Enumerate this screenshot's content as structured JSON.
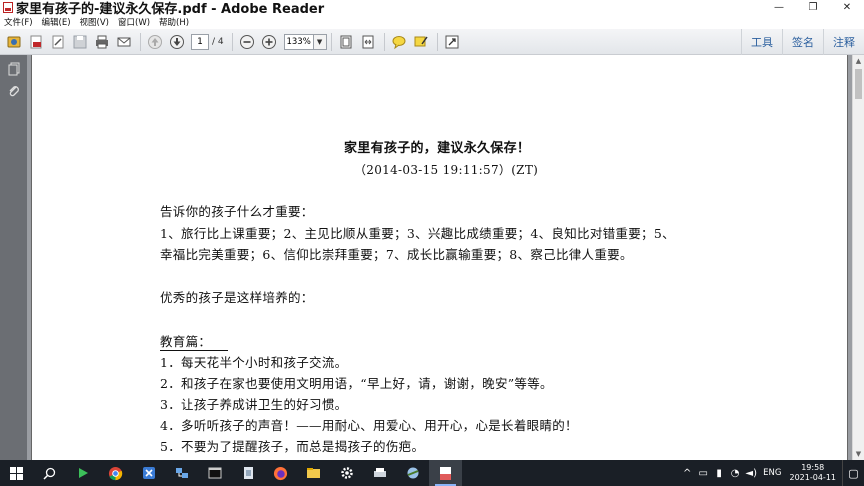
{
  "window": {
    "title": "家里有孩子的-建议永久保存.pdf - Adobe Reader",
    "minimize": "—",
    "restore": "❐",
    "close": "✕"
  },
  "menu": {
    "items": [
      "文件(F)",
      "编辑(E)",
      "视图(V)",
      "窗口(W)",
      "帮助(H)"
    ]
  },
  "toolbar": {
    "page_current": "1",
    "page_total": "/ 4",
    "zoom": "133%",
    "right_links": [
      "工具",
      "签名",
      "注释"
    ]
  },
  "document": {
    "title": "家里有孩子的，建议永久保存！",
    "date": "（2014-03-15 19:11:57）(ZT)",
    "section1_heading": "告诉你的孩子什么才重要：",
    "section1_line1": "1、旅行比上课重要；2、主见比顺从重要；3、兴趣比成绩重要；4、良知比对错重要；5、",
    "section1_line2": "幸福比完美重要；6、信仰比崇拜重要；7、成长比赢输重要；8、察己比律人重要。",
    "section2_heading": "优秀的孩子是这样培养的：",
    "section3_heading": "教育篇：",
    "items": [
      "1．每天花半个小时和孩子交流。",
      "2．和孩子在家也要使用文明用语，“早上好，请，谢谢，晚安”等等。",
      "3．让孩子养成讲卫生的好习惯。",
      "4．多听听孩子的声音！——用耐心、用爱心、用开心，心是长着眼睛的！",
      "5．不要为了提醒孩子，而总是揭孩子的伤疤。"
    ]
  },
  "taskbar": {
    "lang": "ENG",
    "time": "19:58",
    "date": "2021-04-11"
  }
}
